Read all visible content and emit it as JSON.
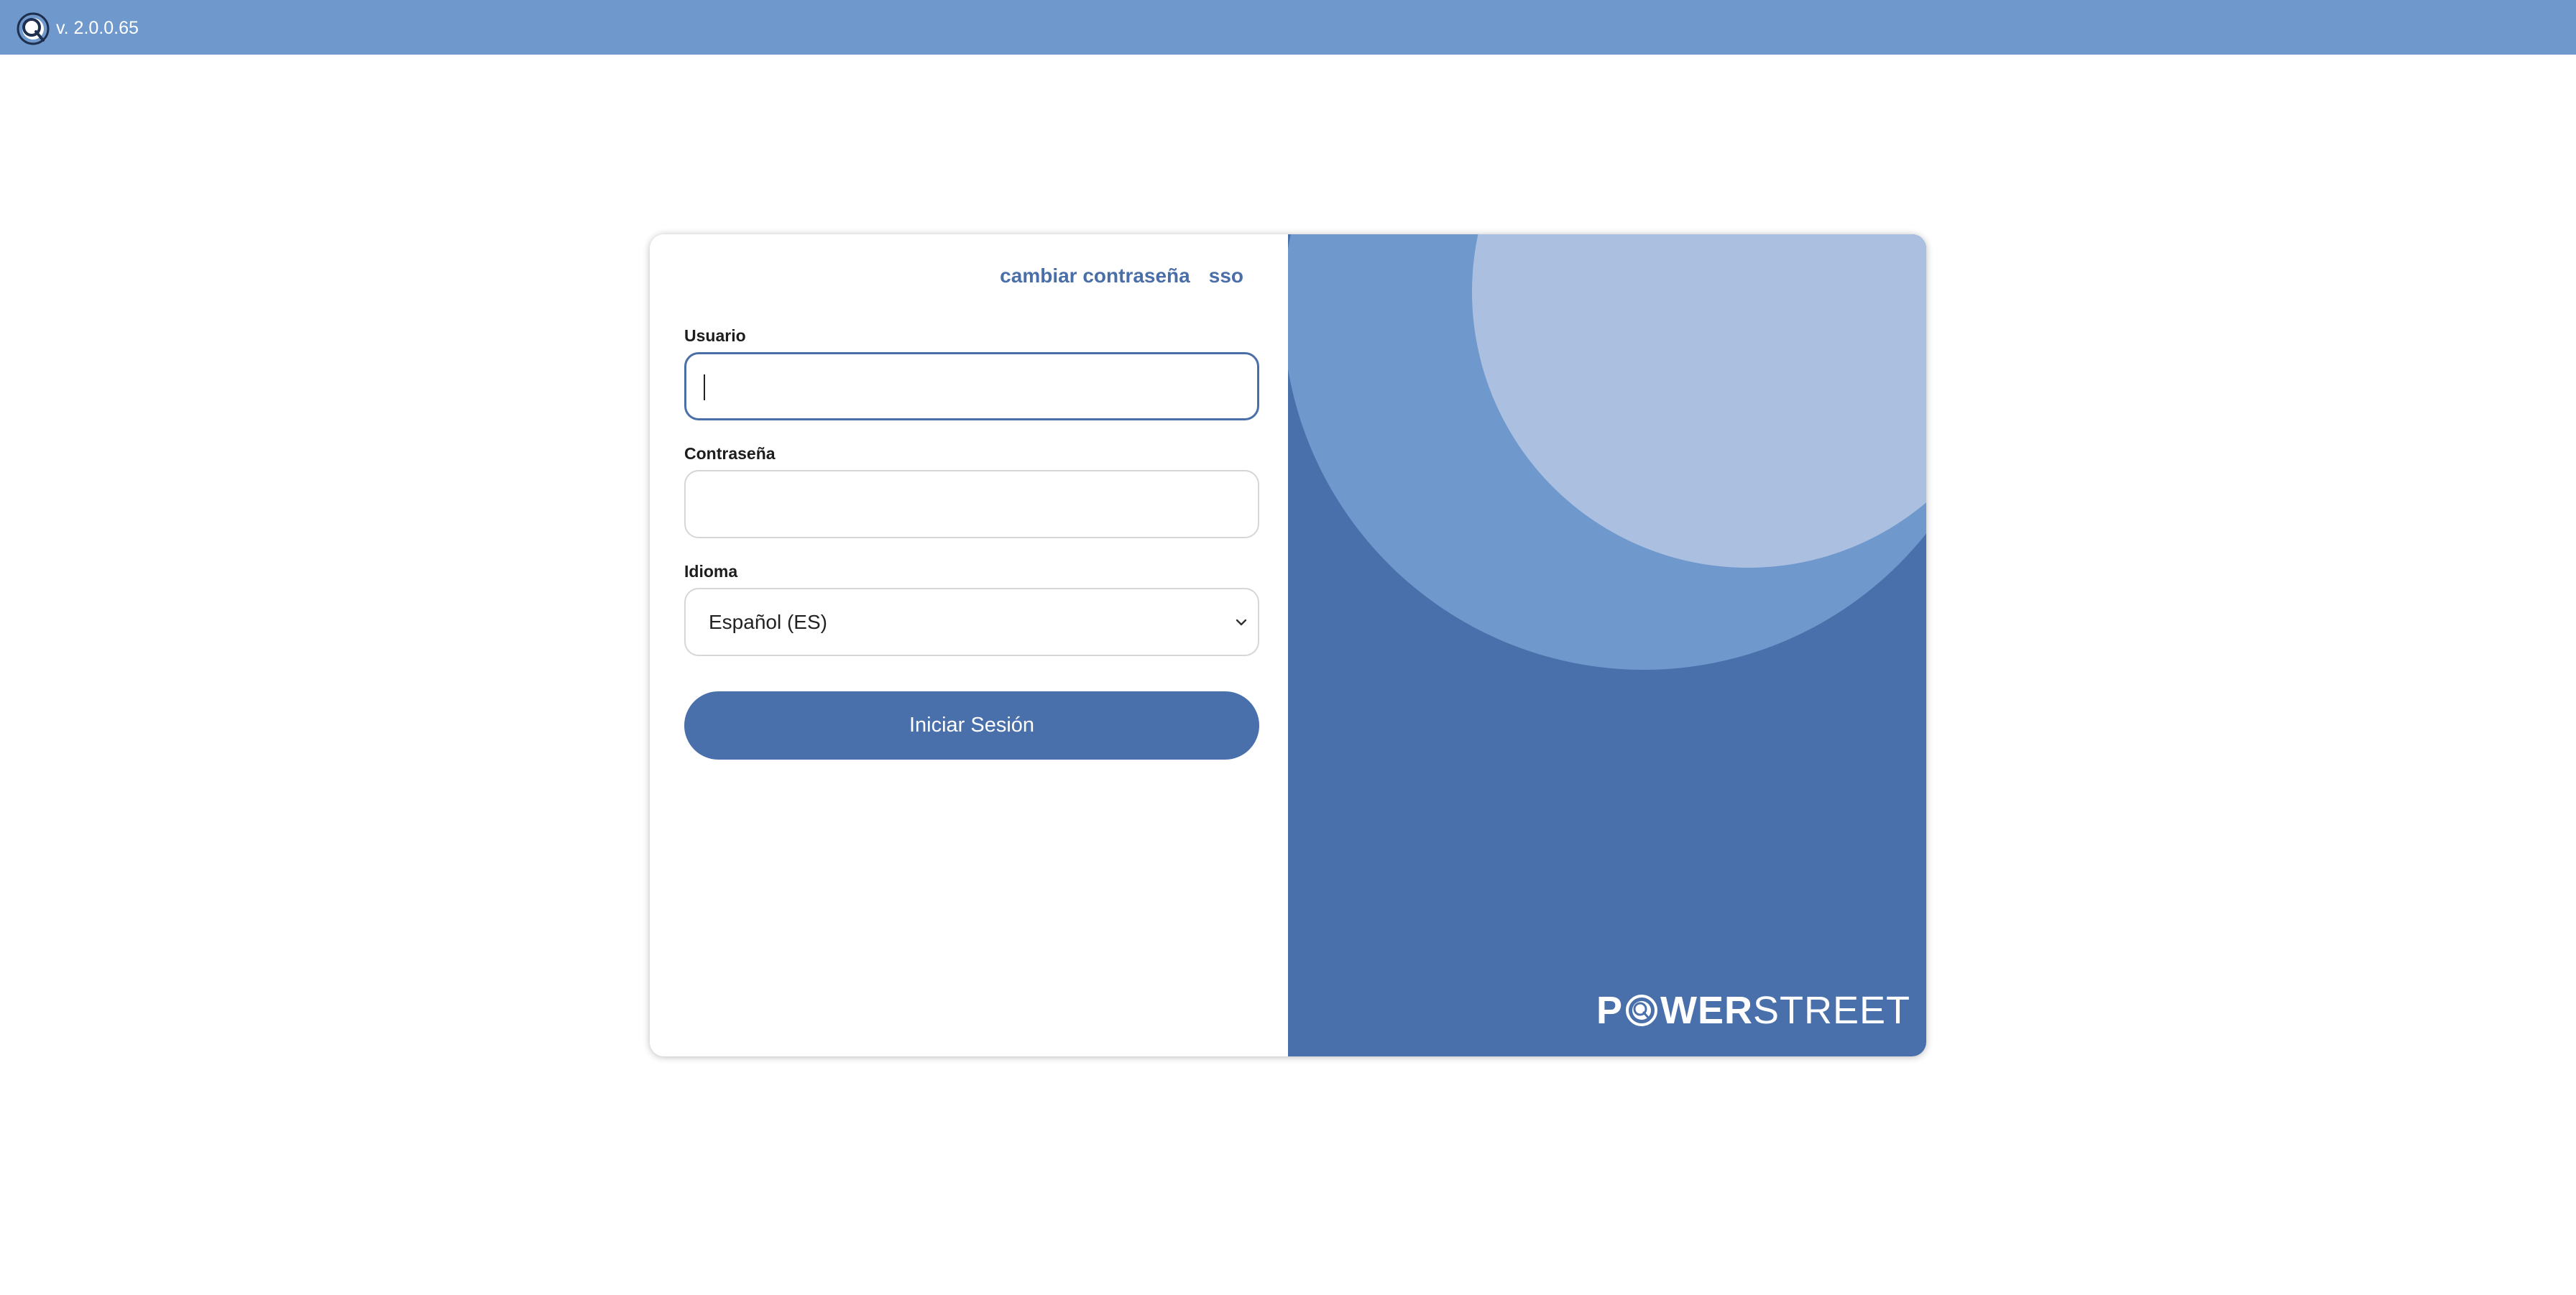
{
  "header": {
    "version": "v. 2.0.0.65",
    "logo_icon": "app-logo-icon",
    "background_color": "#6f98cc"
  },
  "login": {
    "links": {
      "change_password": "cambiar contraseña",
      "sso": "sso"
    },
    "username": {
      "label": "Usuario",
      "value": ""
    },
    "password": {
      "label": "Contraseña",
      "value": ""
    },
    "language": {
      "label": "Idioma",
      "selected": "Español (ES)"
    },
    "submit_label": "Iniciar Sesión"
  },
  "brand": {
    "part1_pre": "P",
    "part1_post": "WER",
    "part2": "STREET"
  },
  "colors": {
    "accent": "#4a70ab",
    "link": "#4a6fa8",
    "art_light": "#abc0e0",
    "art_mid": "#6f98cc"
  }
}
